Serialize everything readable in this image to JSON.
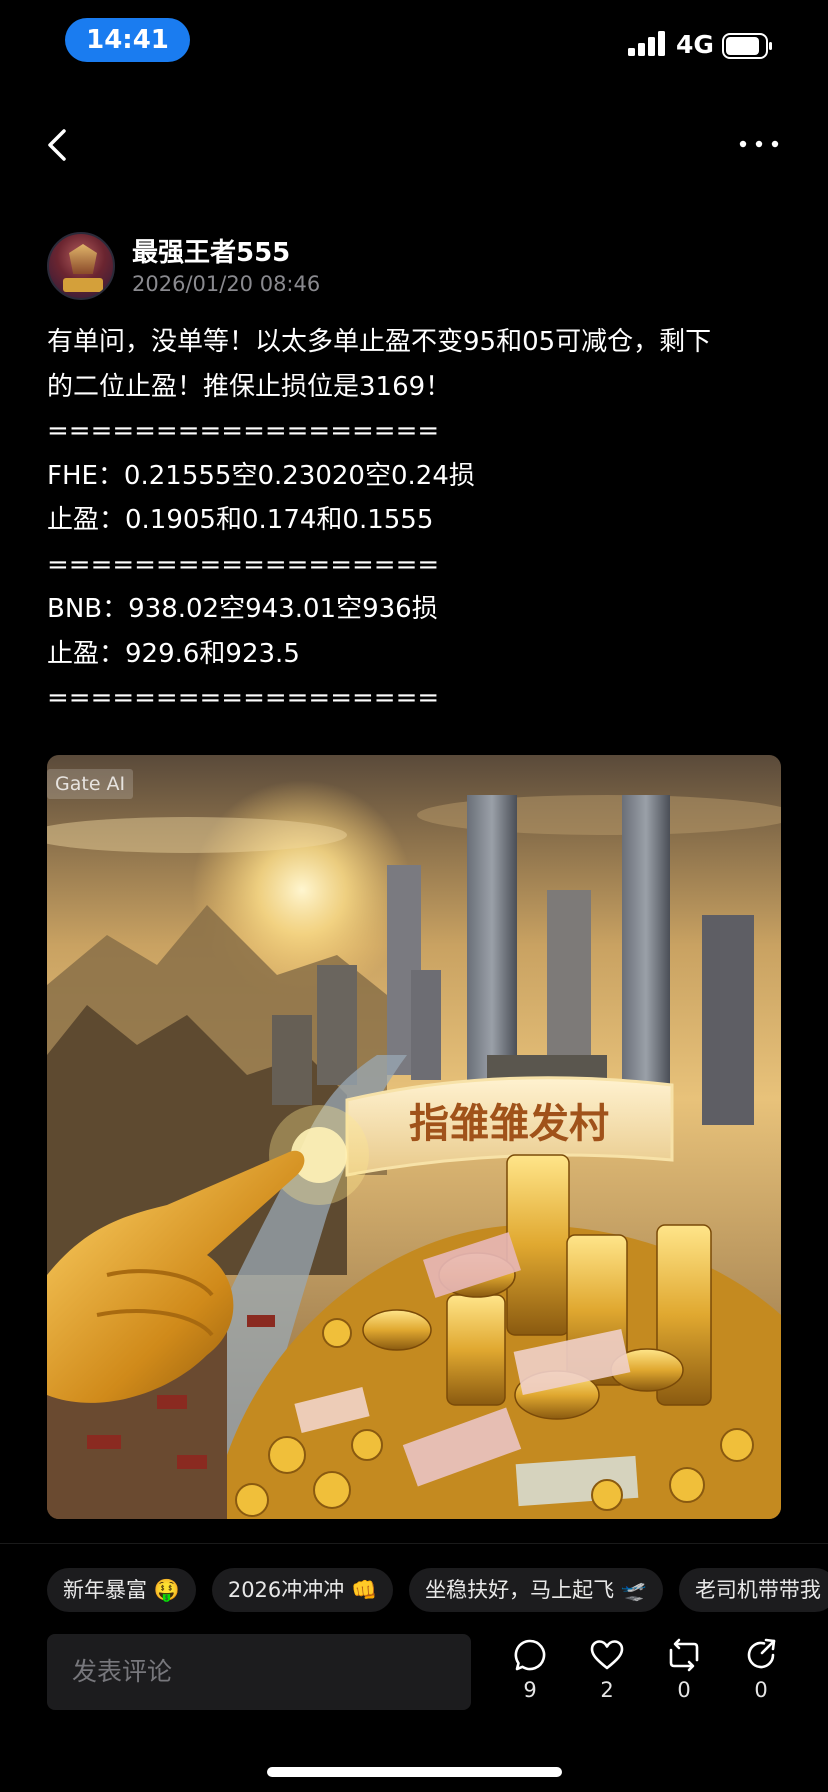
{
  "status_bar": {
    "time": "14:41",
    "network": "4G",
    "signal_icon": "signal-bars-icon",
    "battery_icon": "battery-icon"
  },
  "nav": {
    "back_icon": "chevron-left-icon",
    "more_icon": "more-dots-icon"
  },
  "author": {
    "name": "最强王者555",
    "timestamp": "2026/01/20 08:46"
  },
  "post": {
    "lines": [
      "有单问，没单等！以太多单止盈不变95和05可减仓，剩下",
      "的二位止盈！推保止损位是3169！",
      "==================",
      "FHE：0.21555空0.23020空0.24损",
      "止盈：0.1905和0.174和0.1555",
      "==================",
      "BNB：938.02空943.01空936损",
      "止盈：929.6和923.5",
      "=================="
    ],
    "image": {
      "ai_tag": "Gate AI",
      "banner_text": "指雏雏发村"
    }
  },
  "tags": [
    "新年暴富 🤑",
    "2026冲冲冲 👊",
    "坐稳扶好，马上起飞 🛫",
    "老司机带带我"
  ],
  "comment_box": {
    "placeholder": "发表评论"
  },
  "actions": [
    {
      "name": "comment",
      "icon": "comment-bubble-icon",
      "count": "9"
    },
    {
      "name": "like",
      "icon": "heart-icon",
      "count": "2"
    },
    {
      "name": "repost",
      "icon": "repost-icon",
      "count": "0"
    },
    {
      "name": "share",
      "icon": "share-arrow-icon",
      "count": "0"
    }
  ],
  "colors": {
    "accent": "#1a7cf0",
    "background": "#000000",
    "muted": "#8a8a8f",
    "chip": "#1c1c1e"
  }
}
